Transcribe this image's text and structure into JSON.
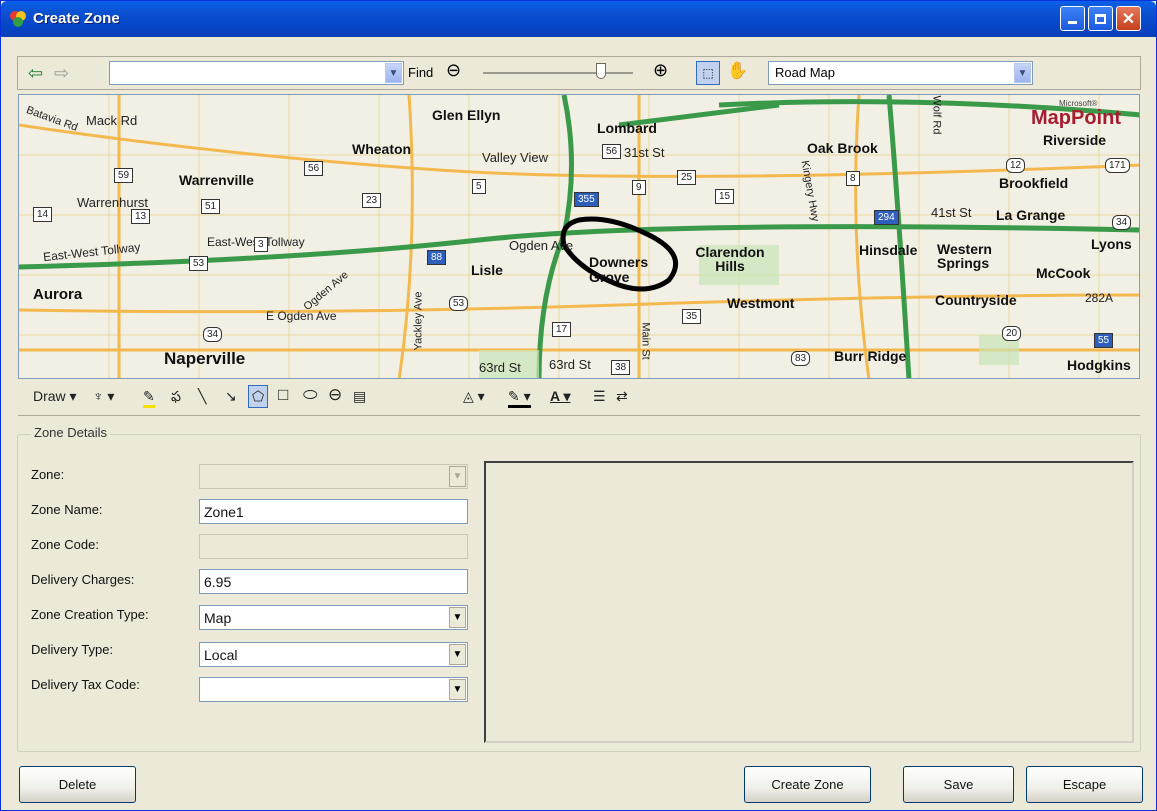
{
  "window": {
    "title": "Create Zone"
  },
  "toolbar": {
    "address_value": "",
    "find_label": "Find",
    "map_style": "Road Map"
  },
  "map": {
    "brand_small": "Microsoft®",
    "brand": "MapPoint",
    "places": [
      "Batavia Rd",
      "Mack Rd",
      "Glen Ellyn",
      "Lombard",
      "Wheaton",
      "Valley View",
      "31st St",
      "Oak Brook",
      "Riverside",
      "Warrenville",
      "Brookfield",
      "Warrenhurst",
      "Kingery Hwy",
      "41st St",
      "La Grange",
      "East-West Tollway",
      "East-West Tollway",
      "Ogden Ave",
      "Clarendon Hills",
      "Hinsdale",
      "Western Springs",
      "Lyons",
      "McCook",
      "Lisle",
      "Downers Grove",
      "Aurora",
      "Westmont",
      "Countryside",
      "282A",
      "Ogden Ave",
      "E Ogden Ave",
      "Yackley Ave",
      "Main St",
      "Naperville",
      "63rd St",
      "63rd St",
      "Burr Ridge",
      "Hodgkins",
      "Wolf Rd"
    ],
    "shields": [
      "59",
      "56",
      "14",
      "13",
      "51",
      "23",
      "5",
      "56",
      "355",
      "25",
      "9",
      "15",
      "8",
      "12",
      "171",
      "294",
      "34",
      "53",
      "3",
      "88",
      "53",
      "17",
      "35",
      "34",
      "20",
      "55",
      "83",
      "38"
    ]
  },
  "drawbar": {
    "draw_label": "Draw"
  },
  "zone_details": {
    "group_title": "Zone Details",
    "zone_label": "Zone:",
    "zone_value": "",
    "zone_name_label": "Zone Name:",
    "zone_name_value": "Zone1",
    "zone_code_label": "Zone Code:",
    "zone_code_value": "",
    "delivery_charges_label": "Delivery Charges:",
    "delivery_charges_value": "6.95",
    "zone_creation_type_label": "Zone Creation Type:",
    "zone_creation_type_value": "Map",
    "delivery_type_label": "Delivery Type:",
    "delivery_type_value": "Local",
    "delivery_tax_code_label": "Delivery Tax Code:",
    "delivery_tax_code_value": ""
  },
  "buttons": {
    "delete": "Delete",
    "create_zone": "Create Zone",
    "save": "Save",
    "escape": "Escape"
  }
}
